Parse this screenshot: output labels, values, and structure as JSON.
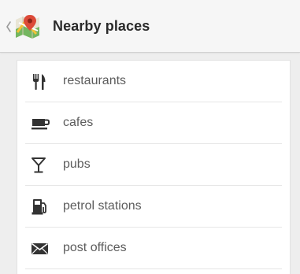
{
  "header": {
    "title": "Nearby places",
    "back_icon": "chevron-left-icon",
    "app_icon": "maps-icon"
  },
  "places": [
    {
      "label": "restaurants",
      "icon": "cutlery-icon"
    },
    {
      "label": "cafes",
      "icon": "coffee-cup-icon"
    },
    {
      "label": "pubs",
      "icon": "cocktail-glass-icon"
    },
    {
      "label": "petrol stations",
      "icon": "fuel-pump-icon"
    },
    {
      "label": "post offices",
      "icon": "envelope-icon"
    }
  ],
  "colors": {
    "action_bar": "#f6f6f6",
    "background": "#eeeeee",
    "list_card": "#ffffff",
    "title_text": "#2a2a2a",
    "item_text": "#5c5c5c",
    "icon": "#333333"
  }
}
